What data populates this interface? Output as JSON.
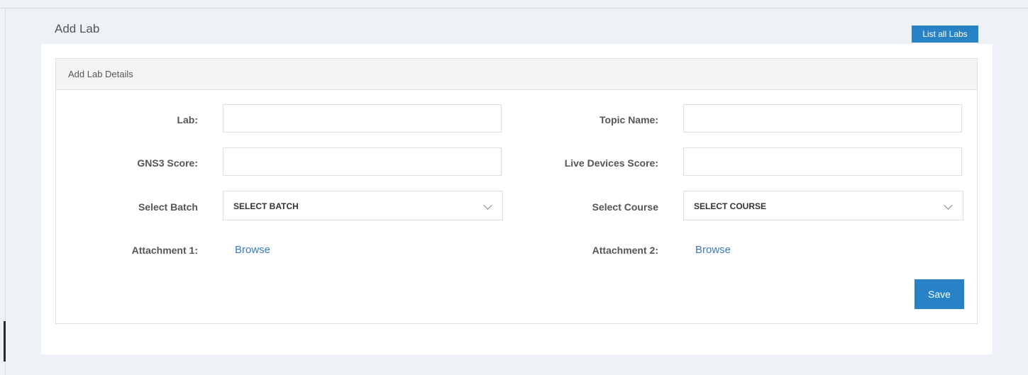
{
  "page": {
    "title": "Add Lab",
    "list_button": "List all Labs"
  },
  "panel": {
    "title": "Add Lab Details"
  },
  "form": {
    "lab": {
      "label": "Lab:",
      "value": ""
    },
    "topic_name": {
      "label": "Topic Name:",
      "value": ""
    },
    "gns3_score": {
      "label": "GNS3 Score:",
      "value": ""
    },
    "live_devices_score": {
      "label": "Live Devices Score:",
      "value": ""
    },
    "select_batch": {
      "label": "Select Batch",
      "selected": "SELECT BATCH"
    },
    "select_course": {
      "label": "Select Course",
      "selected": "SELECT COURSE"
    },
    "attachment_1": {
      "label": "Attachment 1:",
      "link": "Browse"
    },
    "attachment_2": {
      "label": "Attachment 2:",
      "link": "Browse"
    },
    "save_button": "Save"
  },
  "colors": {
    "accent": "#2783c5",
    "link": "#3a7bbf",
    "background": "#eef1f5"
  },
  "icons": {
    "dropdown": "chevron-down-icon"
  }
}
